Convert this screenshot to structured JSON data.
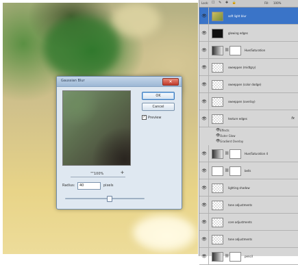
{
  "dialog": {
    "title": "Gaussian Blur",
    "close_glyph": "✕",
    "ok_label": "OK",
    "cancel_label": "Cancel",
    "preview_label": "Preview",
    "preview_checked": "✓",
    "zoom_out_glyph": "−",
    "zoom_in_glyph": "+",
    "zoom_level": "100%",
    "radius_label": "Radius:",
    "radius_value": "40",
    "pixels_label": "pixels",
    "slider_level_fraction": 0.55
  },
  "layers_panel": {
    "lock_label": "Lock:",
    "lock_icons": "☐ ✎ ✚ 🔒",
    "fill_label": "Fill:",
    "fill_value": "100%",
    "layers": [
      {
        "name": "soft light blur",
        "selected": true,
        "thumb": "image"
      },
      {
        "name": "glowing edges",
        "selected": false,
        "thumb": "black"
      },
      {
        "name": "Hue/Saturation",
        "selected": false,
        "thumb": "adjust"
      },
      {
        "name": "sweeppen (midtgry)",
        "selected": false,
        "thumb": "checker"
      },
      {
        "name": "sweeppen (color dodge)",
        "selected": false,
        "thumb": "checker"
      },
      {
        "name": "sweeppen (overlay)",
        "selected": false,
        "thumb": "checker"
      },
      {
        "name": "texture edges",
        "selected": false,
        "thumb": "checker",
        "fx": "fx"
      },
      {
        "name": "Hue/Saturation 4",
        "selected": false,
        "thumb": "adjust"
      },
      {
        "name": "bells",
        "selected": false,
        "thumb": "mask"
      },
      {
        "name": "lighting shadow",
        "selected": false,
        "thumb": "checker"
      },
      {
        "name": "tone adjustments",
        "selected": false,
        "thumb": "checker"
      },
      {
        "name": "core adjustments",
        "selected": false,
        "thumb": "checker"
      },
      {
        "name": "tone adjustments",
        "selected": false,
        "thumb": "checker"
      },
      {
        "name": "pencil",
        "selected": false,
        "thumb": "adjust"
      }
    ],
    "effects_label": "Effects",
    "effects": [
      "Outer Glow",
      "Gradient Overlay"
    ]
  }
}
